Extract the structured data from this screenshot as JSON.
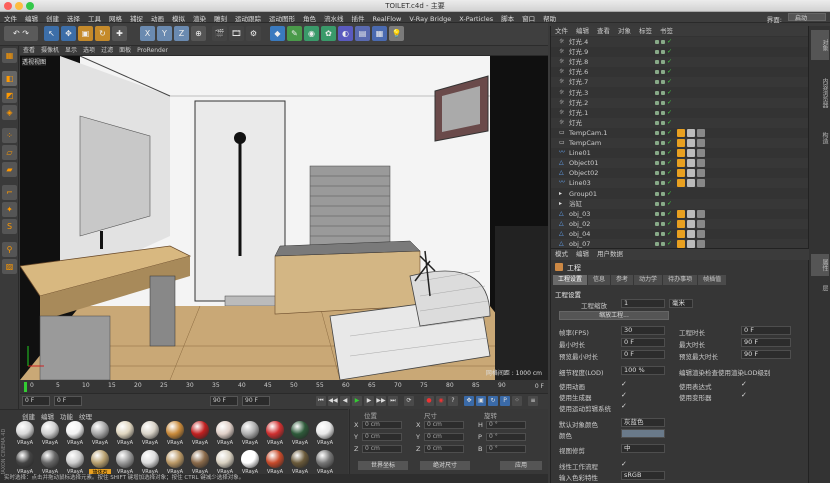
{
  "window": {
    "title": "TOILET.c4d - 主要"
  },
  "menubar": {
    "items": [
      "文件",
      "编辑",
      "创建",
      "选择",
      "工具",
      "网格",
      "捕捉",
      "动画",
      "模拟",
      "渲染",
      "雕刻",
      "运动跟踪",
      "运动图形",
      "角色",
      "流水线",
      "插件",
      "RealFlow",
      "V-Ray Bridge",
      "X-Particles",
      "脚本",
      "窗口",
      "帮助"
    ],
    "layout_label": "界面:",
    "layout_value": "启动"
  },
  "viewport": {
    "menu": [
      "查看",
      "摄像机",
      "显示",
      "选项",
      "过滤",
      "面板",
      "ProRender"
    ],
    "label": "透视视图",
    "grid_text": "网格间距 : 1000 cm"
  },
  "timeline": {
    "ticks": [
      "0",
      "5",
      "10",
      "15",
      "20",
      "25",
      "30",
      "35",
      "40",
      "45",
      "50",
      "55",
      "60",
      "65",
      "70",
      "75",
      "80",
      "85",
      "90"
    ],
    "frame_field": "0 F",
    "start_field": "0 F",
    "end_field": "90 F",
    "end_field2": "90 F",
    "current_frame": "0 F"
  },
  "materials": {
    "menu": [
      "创建",
      "编辑",
      "功能",
      "纹理"
    ],
    "brand": "MAXON CINEMA 4D",
    "row1": [
      {
        "label": "VRayA",
        "color": "#d8d8d8"
      },
      {
        "label": "VRayA",
        "color": "#cfcfcf"
      },
      {
        "label": "VRayA",
        "color": "#f2f2f2"
      },
      {
        "label": "VRayA",
        "color": "#a8a8a8"
      },
      {
        "label": "VRayA",
        "color": "#e0d6c0"
      },
      {
        "label": "VRayA",
        "color": "#d9d3c8"
      },
      {
        "label": "VRayA",
        "color": "#c98a3a"
      },
      {
        "label": "VRayA",
        "color": "#c22020"
      },
      {
        "label": "VRayA",
        "color": "#e0d0c8"
      },
      {
        "label": "VRayA",
        "color": "#b0b0b0"
      },
      {
        "label": "VRayA",
        "color": "#d03030"
      },
      {
        "label": "VRayA",
        "color": "#2e5a3a"
      },
      {
        "label": "VRayA",
        "color": "#e8e8e8"
      }
    ],
    "row2": [
      {
        "label": "VRayA",
        "color": "#444444"
      },
      {
        "label": "VRayA",
        "color": "#666666"
      },
      {
        "label": "VRayA",
        "color": "#cccccc"
      },
      {
        "label": "墙体石",
        "color": "#b8a070"
      },
      {
        "label": "VRayA",
        "color": "#999999"
      },
      {
        "label": "VRayA",
        "color": "#dddddd"
      },
      {
        "label": "VRayA",
        "color": "#bb9966"
      },
      {
        "label": "VRayA",
        "color": "#8a6a4a"
      },
      {
        "label": "VRayA",
        "color": "#d8d0c0"
      },
      {
        "label": "VRayA",
        "color": "#ffffff"
      },
      {
        "label": "VRayA",
        "color": "#c84a2a"
      },
      {
        "label": "VRayA",
        "color": "#6a5a3a"
      },
      {
        "label": "VRayA",
        "color": "#777777"
      }
    ]
  },
  "coords": {
    "header": [
      "位置",
      "尺寸",
      "旋转"
    ],
    "rows": [
      {
        "axis": "X",
        "v1": "0 cm",
        "axis2": "X",
        "v2": "0 cm",
        "axis3": "H",
        "v3": "0 °"
      },
      {
        "axis": "Y",
        "v1": "0 cm",
        "axis2": "Y",
        "v2": "0 cm",
        "axis3": "P",
        "v3": "0 °"
      },
      {
        "axis": "Z",
        "v1": "0 cm",
        "axis2": "Z",
        "v2": "0 cm",
        "axis3": "B",
        "v3": "0 °"
      }
    ],
    "mode": "世界坐标",
    "size_mode": "绝对尺寸",
    "apply": "应用"
  },
  "objects": {
    "menu": [
      "文件",
      "编辑",
      "查看",
      "对象",
      "标签",
      "书签"
    ],
    "items": [
      {
        "name": "灯光.4",
        "type": "light"
      },
      {
        "name": "灯光.9",
        "type": "light"
      },
      {
        "name": "灯光.8",
        "type": "light"
      },
      {
        "name": "灯光.6",
        "type": "light"
      },
      {
        "name": "灯光.7",
        "type": "light"
      },
      {
        "name": "灯光.3",
        "type": "light"
      },
      {
        "name": "灯光.2",
        "type": "light"
      },
      {
        "name": "灯光.1",
        "type": "light"
      },
      {
        "name": "灯光",
        "type": "light"
      },
      {
        "name": "TempCam.1",
        "type": "camera"
      },
      {
        "name": "TempCam",
        "type": "camera"
      },
      {
        "name": "Line01",
        "type": "spline"
      },
      {
        "name": "Object01",
        "type": "object"
      },
      {
        "name": "Object02",
        "type": "object"
      },
      {
        "name": "Line03",
        "type": "spline"
      },
      {
        "name": "Group01",
        "type": "group"
      },
      {
        "name": "浴缸",
        "type": "group"
      },
      {
        "name": "obj_03",
        "type": "object"
      },
      {
        "name": "obj_02",
        "type": "object"
      },
      {
        "name": "obj_04",
        "type": "object"
      },
      {
        "name": "obj_07",
        "type": "object"
      }
    ]
  },
  "attributes": {
    "menu": [
      "模式",
      "编辑",
      "用户数据"
    ],
    "title": "工程",
    "tabs": [
      "工程设置",
      "信息",
      "参考",
      "动力学",
      "待办事项",
      "帧插值"
    ],
    "section": "工程设置",
    "scale_label": "工程缩放",
    "scale_value": "1",
    "scale_unit": "毫米",
    "scale_button": "缩放工程...",
    "fps_label": "帧率(FPS)",
    "fps_value": "30",
    "min_time_label": "最小时长",
    "min_time_value": "0 F",
    "preview_min_label": "预览最小时长",
    "preview_min_value": "0 F",
    "lod_label": "细节程度(LOD)",
    "lod_value": "100 %",
    "project_time_label": "工程时长",
    "project_time_value": "0 F",
    "max_time_label": "最大时长",
    "max_time_value": "90 F",
    "preview_max_label": "预览最大时长",
    "preview_max_value": "90 F",
    "render_lod_label": "编辑渲染检查使用渲染LOD级别",
    "use_anim": "使用动画",
    "use_expr": "使用表达式",
    "use_gen": "使用生成器",
    "use_deform": "使用变形器",
    "use_motion": "使用运动剪辑系统",
    "default_color_label": "默认对象颜色",
    "default_color_value": "灰蓝色",
    "color_label": "颜色",
    "view_clip_label": "视图修剪",
    "view_clip_value": "中",
    "linear_label": "线性工作流程",
    "input_color_label": "输入色彩特性",
    "input_color_value": "sRGB"
  },
  "sidebar_tabs": [
    "对象",
    "内容浏览器",
    "构造",
    "层",
    "属性"
  ],
  "status": {
    "text": "实时选择：点击并拖动鼠标选择元素。按住 SHIFT 键增加选择对象；按住 CTRL 键减少选择对象。"
  }
}
